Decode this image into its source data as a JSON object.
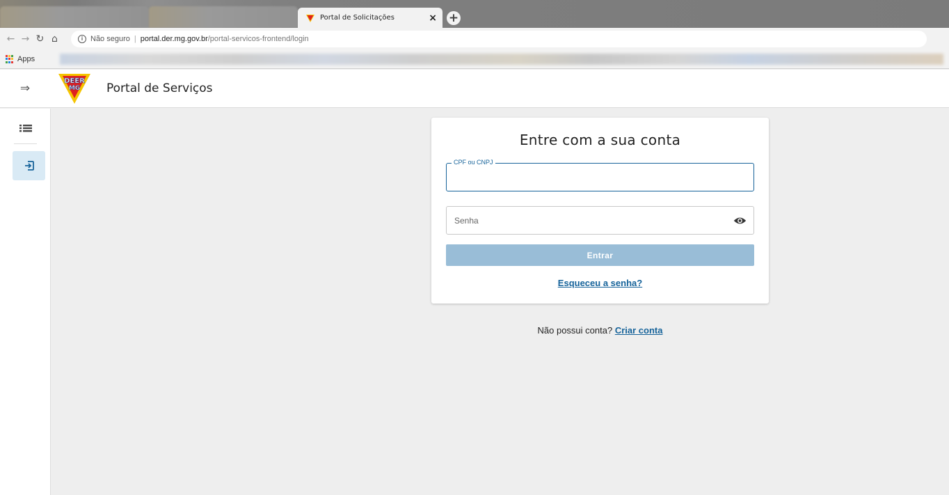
{
  "browser": {
    "tab_title": "Portal de Solicitações",
    "tab_close": "×",
    "new_tab": "+",
    "security_label": "Não seguro",
    "url_host": "portal.der.mg.gov.br",
    "url_path": "/portal-servicos-frontend/login",
    "bookmarks_apps": "Apps",
    "nav_icons": [
      "back-icon",
      "forward-icon",
      "reload-icon",
      "home-icon"
    ]
  },
  "header": {
    "menu_icon": "⇒",
    "logo_text_top": "DEER",
    "logo_text_bottom": "MG",
    "title": "Portal de Serviços"
  },
  "sidebar": {
    "items": [
      {
        "icon": "list-icon",
        "active": false
      },
      {
        "icon": "login-icon",
        "active": true
      }
    ]
  },
  "login": {
    "title": "Entre com a sua conta",
    "cpf_label": "CPF ou CNPJ",
    "cpf_value": "",
    "password_placeholder": "Senha",
    "submit_label": "Entrar",
    "forgot_label": "Esqueceu a senha?",
    "no_account_text": "Não possui conta?",
    "create_account_label": "Criar conta"
  },
  "colors": {
    "primary": "#16639a",
    "button_disabled": "#99bdd7",
    "sidebar_active": "#d9eaf5",
    "background": "#eeeeee"
  }
}
